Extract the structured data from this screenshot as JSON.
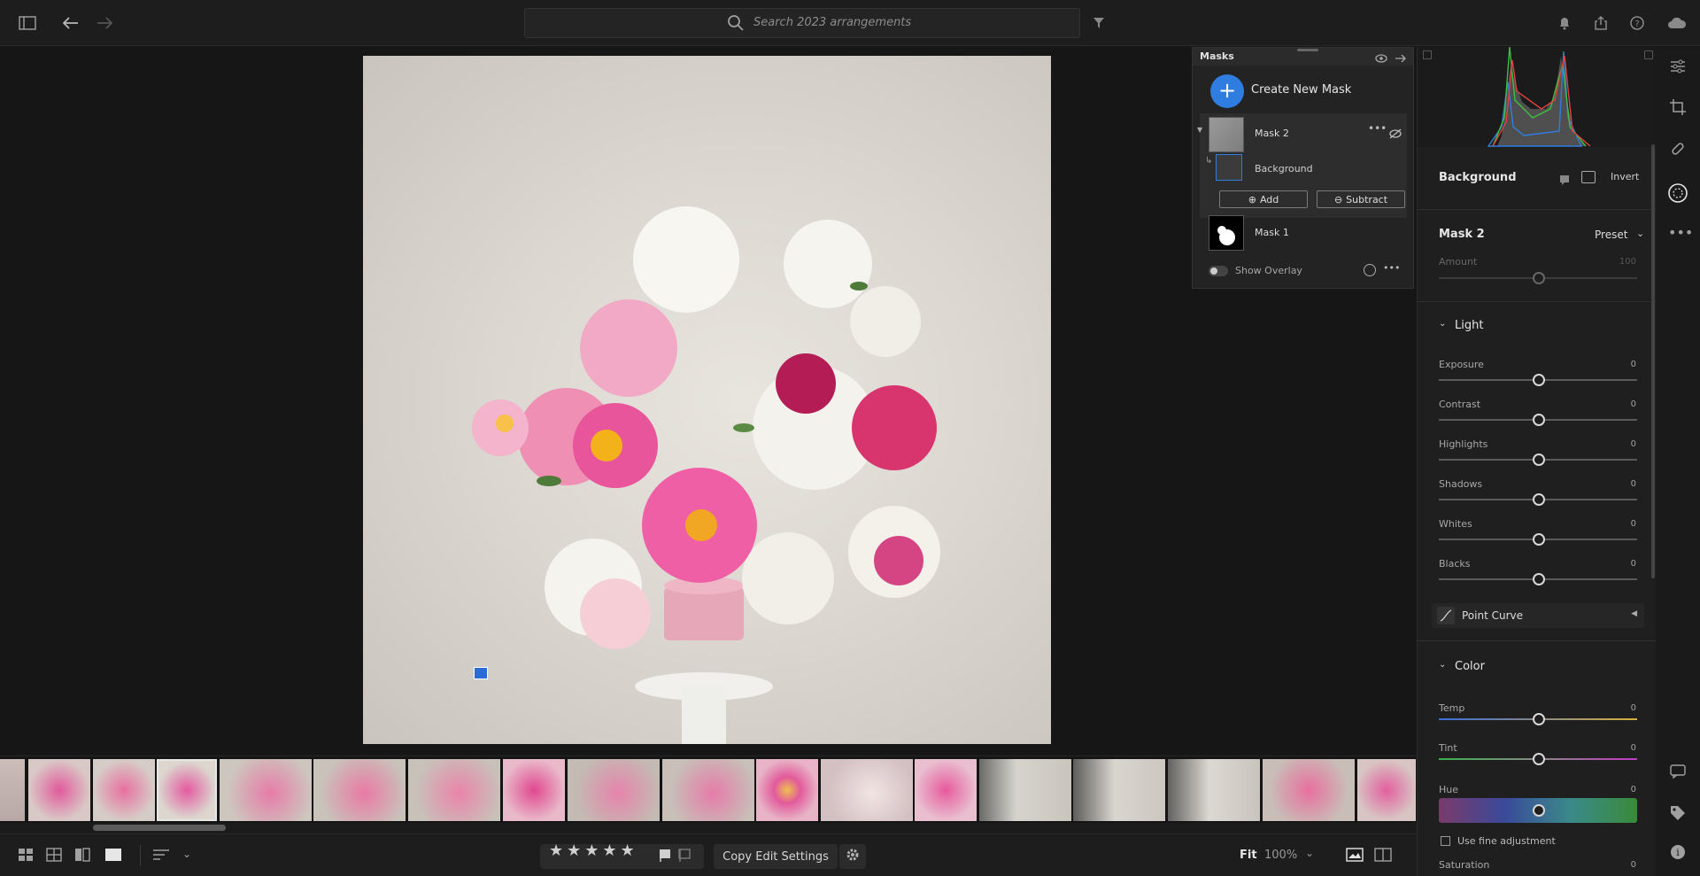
{
  "topbar": {
    "search_placeholder": "Search 2023 arrangements"
  },
  "masks_panel": {
    "title": "Masks",
    "create_label": "Create New Mask",
    "mask2": {
      "name": "Mask 2",
      "component": "Background"
    },
    "add_label": "Add",
    "subtract_label": "Subtract",
    "mask1": {
      "name": "Mask 1"
    },
    "show_overlay_label": "Show Overlay"
  },
  "edit_panel": {
    "selection_title": "Background",
    "invert_label": "Invert",
    "mask_title": "Mask 2",
    "preset_label": "Preset",
    "amount": {
      "label": "Amount",
      "value": "100"
    },
    "light": {
      "title": "Light",
      "sliders": [
        {
          "label": "Exposure",
          "value": "0"
        },
        {
          "label": "Contrast",
          "value": "0"
        },
        {
          "label": "Highlights",
          "value": "0"
        },
        {
          "label": "Shadows",
          "value": "0"
        },
        {
          "label": "Whites",
          "value": "0"
        },
        {
          "label": "Blacks",
          "value": "0"
        }
      ]
    },
    "point_curve_label": "Point Curve",
    "color": {
      "title": "Color",
      "temp": {
        "label": "Temp",
        "value": "0"
      },
      "tint": {
        "label": "Tint",
        "value": "0"
      },
      "hue": {
        "label": "Hue",
        "value": "0"
      },
      "fine_adjust_label": "Use fine adjustment",
      "saturation": {
        "label": "Saturation",
        "value": "0"
      }
    }
  },
  "bottombar": {
    "copy_edit_label": "Copy Edit Settings",
    "fit_label": "Fit",
    "zoom_label": "100%"
  },
  "colors": {
    "accent": "#2f7de1",
    "panel": "#1f1f1f",
    "background": "#161616"
  }
}
